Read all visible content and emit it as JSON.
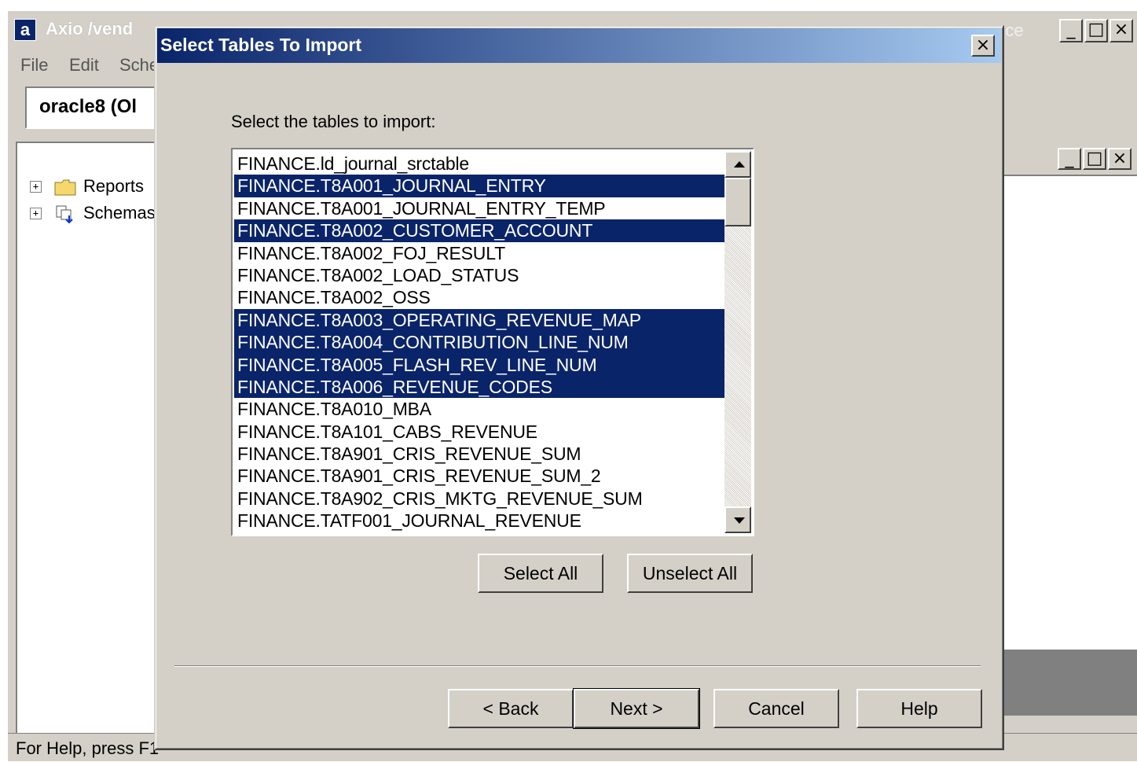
{
  "app": {
    "title": "Axio /vend",
    "title_right": "rce",
    "menu": [
      "File",
      "Edit",
      "Sche"
    ],
    "connection": "oracle8 (Ol",
    "tree": [
      {
        "label": "Reports",
        "icon": "folder-icon"
      },
      {
        "label": "Schemas",
        "icon": "schema-icon"
      }
    ],
    "status": "For Help, press F1"
  },
  "dialog": {
    "title": "Select Tables To Import",
    "prompt": "Select the tables to import:",
    "tables": [
      {
        "name": "FINANCE.ld_journal_srctable",
        "selected": false
      },
      {
        "name": "FINANCE.T8A001_JOURNAL_ENTRY",
        "selected": true
      },
      {
        "name": "FINANCE.T8A001_JOURNAL_ENTRY_TEMP",
        "selected": false
      },
      {
        "name": "FINANCE.T8A002_CUSTOMER_ACCOUNT",
        "selected": true
      },
      {
        "name": "FINANCE.T8A002_FOJ_RESULT",
        "selected": false
      },
      {
        "name": "FINANCE.T8A002_LOAD_STATUS",
        "selected": false
      },
      {
        "name": "FINANCE.T8A002_OSS",
        "selected": false
      },
      {
        "name": "FINANCE.T8A003_OPERATING_REVENUE_MAP",
        "selected": true
      },
      {
        "name": "FINANCE.T8A004_CONTRIBUTION_LINE_NUM",
        "selected": true
      },
      {
        "name": "FINANCE.T8A005_FLASH_REV_LINE_NUM",
        "selected": true
      },
      {
        "name": "FINANCE.T8A006_REVENUE_CODES",
        "selected": true
      },
      {
        "name": "FINANCE.T8A010_MBA",
        "selected": false
      },
      {
        "name": "FINANCE.T8A101_CABS_REVENUE",
        "selected": false
      },
      {
        "name": "FINANCE.T8A901_CRIS_REVENUE_SUM",
        "selected": false
      },
      {
        "name": "FINANCE.T8A901_CRIS_REVENUE_SUM_2",
        "selected": false
      },
      {
        "name": "FINANCE.T8A902_CRIS_MKTG_REVENUE_SUM",
        "selected": false
      },
      {
        "name": "FINANCE.TATF001_JOURNAL_REVENUE",
        "selected": false
      }
    ],
    "buttons": {
      "select_all": "Select All",
      "unselect_all": "Unselect All",
      "back": "< Back",
      "next": "Next >",
      "cancel": "Cancel",
      "help": "Help"
    },
    "colors": {
      "selection": "#0a246a",
      "face": "#d4d0c8",
      "titlebar_start": "#0a246a",
      "titlebar_end": "#a6caf0"
    }
  }
}
